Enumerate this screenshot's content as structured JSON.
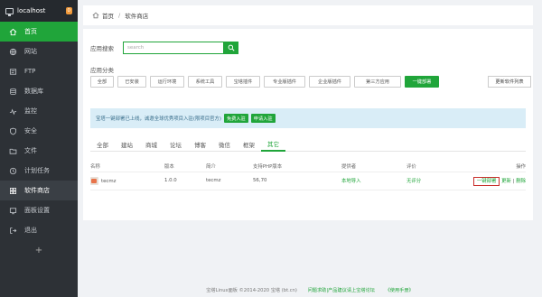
{
  "sidebar": {
    "host": "localhost",
    "badge": "0",
    "items": [
      {
        "label": "首页",
        "icon": "home-icon",
        "state": "active"
      },
      {
        "label": "网站",
        "icon": "globe-icon",
        "state": ""
      },
      {
        "label": "FTP",
        "icon": "ftp-icon",
        "state": ""
      },
      {
        "label": "数据库",
        "icon": "database-icon",
        "state": ""
      },
      {
        "label": "监控",
        "icon": "monitor-icon",
        "state": ""
      },
      {
        "label": "安全",
        "icon": "shield-icon",
        "state": ""
      },
      {
        "label": "文件",
        "icon": "folder-icon",
        "state": ""
      },
      {
        "label": "计划任务",
        "icon": "clock-icon",
        "state": ""
      },
      {
        "label": "软件商店",
        "icon": "grid-icon",
        "state": "hl"
      },
      {
        "label": "面板设置",
        "icon": "settings-icon",
        "state": ""
      },
      {
        "label": "退出",
        "icon": "logout-icon",
        "state": ""
      }
    ],
    "add_label": "+"
  },
  "breadcrumb": {
    "home": "首页",
    "sep": "/",
    "current": "软件商店"
  },
  "search": {
    "label": "应用搜索",
    "placeholder": "search"
  },
  "categories": {
    "label": "应用分类",
    "items": [
      "全部",
      "已安装",
      "运行环境",
      "系统工具",
      "宝塔插件",
      "专业版插件",
      "企业版插件",
      "第三方应用",
      "一键部署"
    ],
    "active_index": 8,
    "update_label": "更新软件列表"
  },
  "notice": {
    "text": "宝塔一键部署已上线，诚邀全球优秀项目入驻(限项目官方)",
    "btn1": "免费入驻",
    "btn2": "申请入驻"
  },
  "tabs": {
    "items": [
      "全部",
      "建站",
      "商城",
      "论坛",
      "博客",
      "微信",
      "框架",
      "其它"
    ],
    "active_index": 7
  },
  "table": {
    "headers": [
      "名称",
      "版本",
      "简介",
      "支持PHP版本",
      "提供者",
      "评价",
      "操作"
    ],
    "rows": [
      {
        "name": "tecmz",
        "version": "1.0.0",
        "intro": "tecmz",
        "php": "56,70",
        "provider": "本地导入",
        "rating": "无评分",
        "action_deploy": "一键部署",
        "action_update": "更新",
        "action_sep": "|",
        "action_delete": "删除"
      }
    ]
  },
  "footer": {
    "copyright": "宝塔Linux面板 ©2014-2020 宝塔 (bt.cn)",
    "link1": "问题求助|产品建议请上宝塔论坛",
    "link2": "《使用手册》"
  },
  "colors": {
    "accent": "#20a53a",
    "sidebar": "#2d3136",
    "highlight_border": "#c9302c"
  }
}
